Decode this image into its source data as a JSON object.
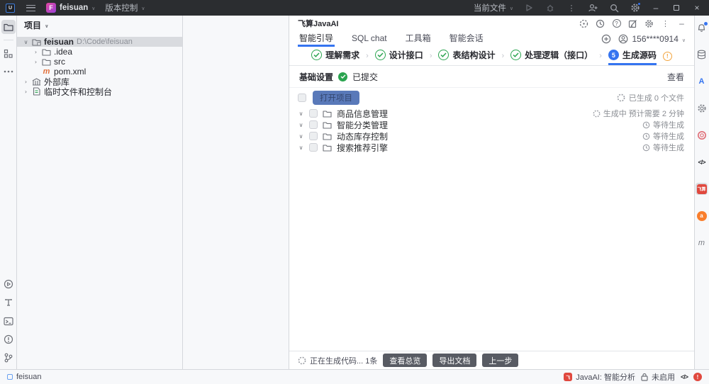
{
  "titlebar": {
    "project": "feisuan",
    "vcs_menu": "版本控制",
    "run_config": "当前文件",
    "project_badge": "F"
  },
  "project_panel": {
    "header": "项目",
    "tree": [
      {
        "name": "feisuan",
        "path": "D:\\Code\\feisuan"
      },
      {
        "name": ".idea"
      },
      {
        "name": "src"
      },
      {
        "name": "pom.xml"
      },
      {
        "name": "外部库"
      },
      {
        "name": "临时文件和控制台"
      }
    ]
  },
  "plugin": {
    "title": "飞算JavaAI",
    "tabs": [
      {
        "label": "智能引导"
      },
      {
        "label": "SQL chat"
      },
      {
        "label": "工具箱"
      },
      {
        "label": "智能会话"
      }
    ],
    "account": "156****0914",
    "steps": [
      {
        "label": "理解需求"
      },
      {
        "label": "设计接口"
      },
      {
        "label": "表结构设计"
      },
      {
        "label": "处理逻辑（接口）"
      },
      {
        "label": "生成源码",
        "num": "5"
      }
    ],
    "settings": {
      "label": "基础设置",
      "status": "已提交",
      "action": "查看"
    },
    "toolbar": {
      "open_project": "打开项目",
      "generated": "已生成 0 个文件"
    },
    "modules": [
      {
        "name": "商品信息管理",
        "status": "生成中 预计需要 2 分钟"
      },
      {
        "name": "智能分类管理",
        "status": "等待生成"
      },
      {
        "name": "动态库存控制",
        "status": "等待生成"
      },
      {
        "name": "搜索推荐引擎",
        "status": "等待生成"
      }
    ],
    "footer": {
      "status": "正在生成代码... 1条",
      "view_overview": "查看总览",
      "export_doc": "导出文档",
      "prev_step": "上一步"
    }
  },
  "statusbar": {
    "project": "feisuan",
    "plugin_label": "JavaAI: 智能分析",
    "lock_state": "未启用"
  },
  "icons": {
    "maven_glyph": "m",
    "translate_glyph": "A",
    "code_glyph": "</>",
    "help_glyph": "?",
    "warn_glyph": "!",
    "error_glyph": "!",
    "check_glyph": "✓",
    "logo_glyph": "U"
  },
  "colors": {
    "accent": "#3574F0",
    "green": "#2AA44F",
    "warning": "#F2A33C",
    "plugin_red": "#E0483E",
    "plugin_orange": "#F97E2C",
    "badge_pink_purple": "#D64CA8"
  }
}
